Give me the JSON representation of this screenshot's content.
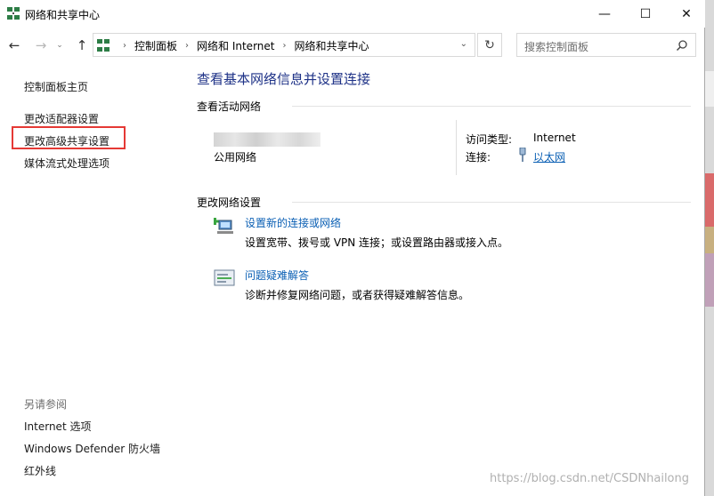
{
  "window": {
    "title": "网络和共享中心",
    "controls": {
      "minimize": "—",
      "maximize": "☐",
      "close": "✕"
    }
  },
  "address_bar": {
    "crumbs": [
      "控制面板",
      "网络和 Internet",
      "网络和共享中心"
    ],
    "search_placeholder": "搜索控制面板"
  },
  "left_pane": {
    "home": "控制面板主页",
    "links": [
      "更改适配器设置",
      "更改高级共享设置",
      "媒体流式处理选项"
    ],
    "highlighted_link_index": 1,
    "see_also_title": "另请参阅",
    "see_also": [
      "Internet 选项",
      "Windows Defender 防火墙",
      "红外线"
    ]
  },
  "main": {
    "heading": "查看基本网络信息并设置连接",
    "active_networks_label": "查看活动网络",
    "network_type": "公用网络",
    "access_type_label": "访问类型:",
    "access_type_value": "Internet",
    "connection_label": "连接:",
    "connection_value": "以太网",
    "change_settings_label": "更改网络设置",
    "tasks": [
      {
        "title": "设置新的连接或网络",
        "desc": "设置宽带、拨号或 VPN 连接；或设置路由器或接入点。",
        "icon": "new-connection-icon"
      },
      {
        "title": "问题疑难解答",
        "desc": "诊断并修复网络问题，或者获得疑难解答信息。",
        "icon": "troubleshoot-icon"
      }
    ]
  },
  "watermark": "https://blog.csdn.net/CSDNhailong",
  "colors": {
    "heading": "#1e3287",
    "link": "#0a5fb4",
    "highlight": "#e53935"
  }
}
